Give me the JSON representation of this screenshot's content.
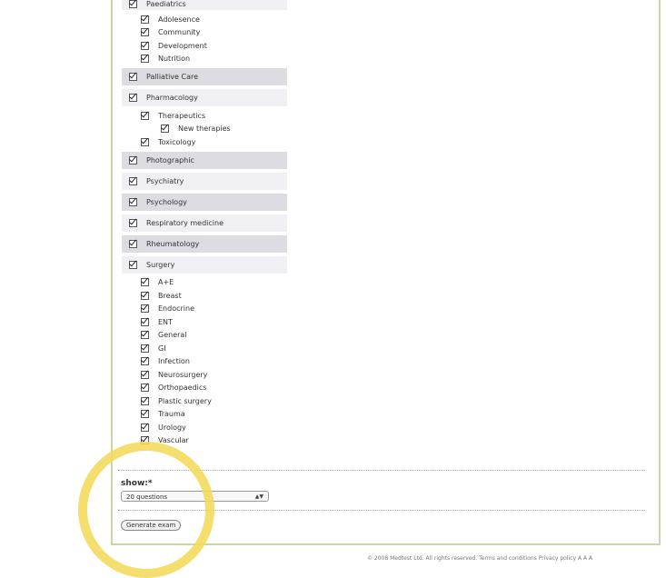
{
  "categories": [
    {
      "label": "Paediatrics",
      "shade": "light",
      "subs": [
        "Adolesence",
        "Community",
        "Development",
        "Nutrition"
      ]
    },
    {
      "label": "Palliative Care",
      "shade": "dark",
      "subs": []
    },
    {
      "label": "Pharmacology",
      "shade": "light",
      "subs": [
        "Therapeutics",
        "Toxicology"
      ],
      "sub_sub": {
        "after": 0,
        "label": "New therapies"
      }
    },
    {
      "label": "Photographic",
      "shade": "dark",
      "subs": []
    },
    {
      "label": "Psychiatry",
      "shade": "light",
      "subs": []
    },
    {
      "label": "Psychology",
      "shade": "dark",
      "subs": []
    },
    {
      "label": "Respiratory medicine",
      "shade": "light",
      "subs": []
    },
    {
      "label": "Rheumatology",
      "shade": "dark",
      "subs": []
    },
    {
      "label": "Surgery",
      "shade": "light",
      "subs": [
        "A+E",
        "Breast",
        "Endocrine",
        "ENT",
        "General",
        "GI",
        "Infection",
        "Neurosurgery",
        "Orthopaedics",
        "Plastic surgery",
        "Trauma",
        "Urology",
        "Vascular"
      ]
    }
  ],
  "show": {
    "label": "show:*",
    "selected": "20 questions"
  },
  "generate_label": "Generate exam",
  "footer": "© 2008 Medtest Ltd.  All rights reserved.  Terms and conditions  Privacy policy  A A A",
  "colors": {
    "highlight": "#f2d95a",
    "frame": "#c9d6a8",
    "row_dark": "#dcdce2",
    "row_light": "#f0f0f4"
  }
}
